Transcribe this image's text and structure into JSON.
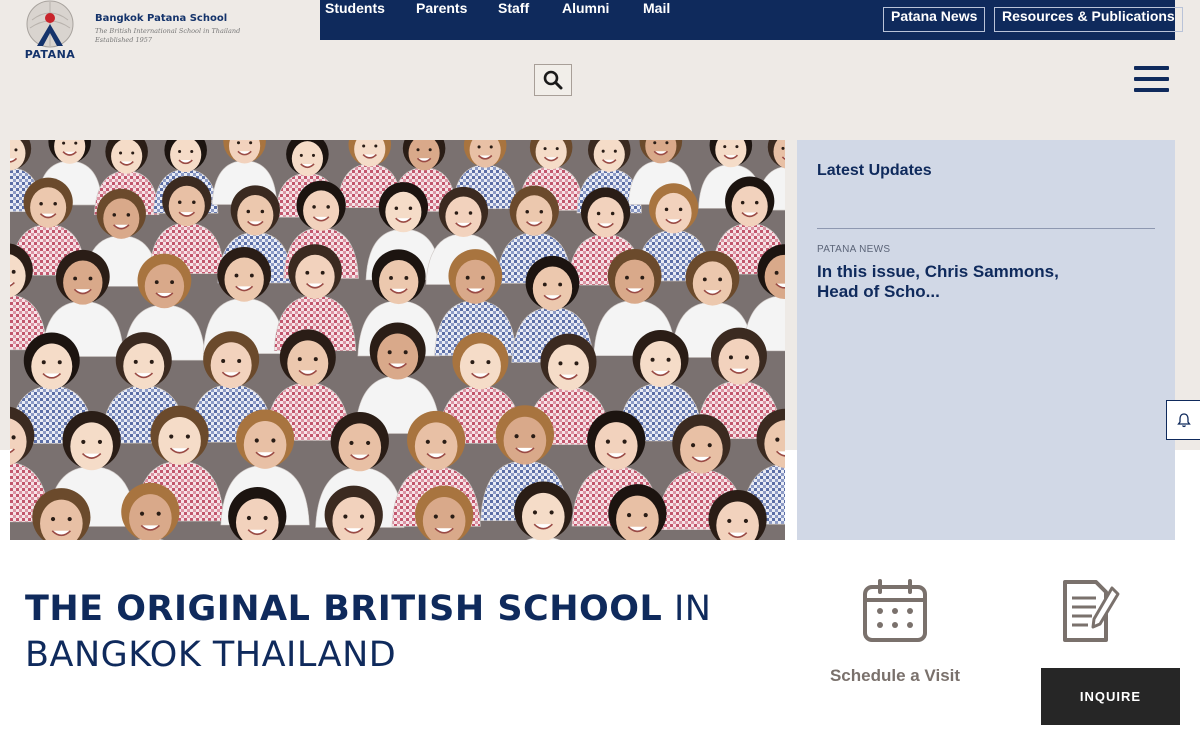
{
  "logo": {
    "wordmark": "PATANA",
    "school_name": "Bangkok Patana School",
    "tagline": "The British International School in Thailand",
    "established": "Established 1957"
  },
  "topnav": {
    "items": [
      {
        "label": "Students"
      },
      {
        "label": "Parents"
      },
      {
        "label": "Staff"
      },
      {
        "label": "Alumni"
      },
      {
        "label": "Mail"
      }
    ],
    "boxed": [
      {
        "label": "Patana News"
      },
      {
        "label": "Resources & Publications"
      }
    ]
  },
  "search": {
    "icon": "search-icon"
  },
  "menu": {
    "icon": "hamburger-icon"
  },
  "hero": {
    "image": "students-group-photo"
  },
  "updates": {
    "title": "Latest Updates",
    "items": [
      {
        "category": "PATANA NEWS",
        "headline": "In this issue, Chris Sammons, Head of Scho..."
      }
    ]
  },
  "headline": {
    "bold_part": "THE ORIGINAL BRITISH SCHOOL",
    "rest_part": " IN BANGKOK THAILAND"
  },
  "quick_links": [
    {
      "label": "Schedule a Visit",
      "icon": "calendar-icon"
    },
    {
      "label": "",
      "icon": "document-pen-icon"
    }
  ],
  "inquire": {
    "label": "INQUIRE"
  },
  "colors": {
    "navy": "#0f2a5c",
    "header_bg": "#eeeae6",
    "panel_bg": "#d1d8e6",
    "icon_taupe": "#7a716c",
    "dark_button": "#262626"
  }
}
